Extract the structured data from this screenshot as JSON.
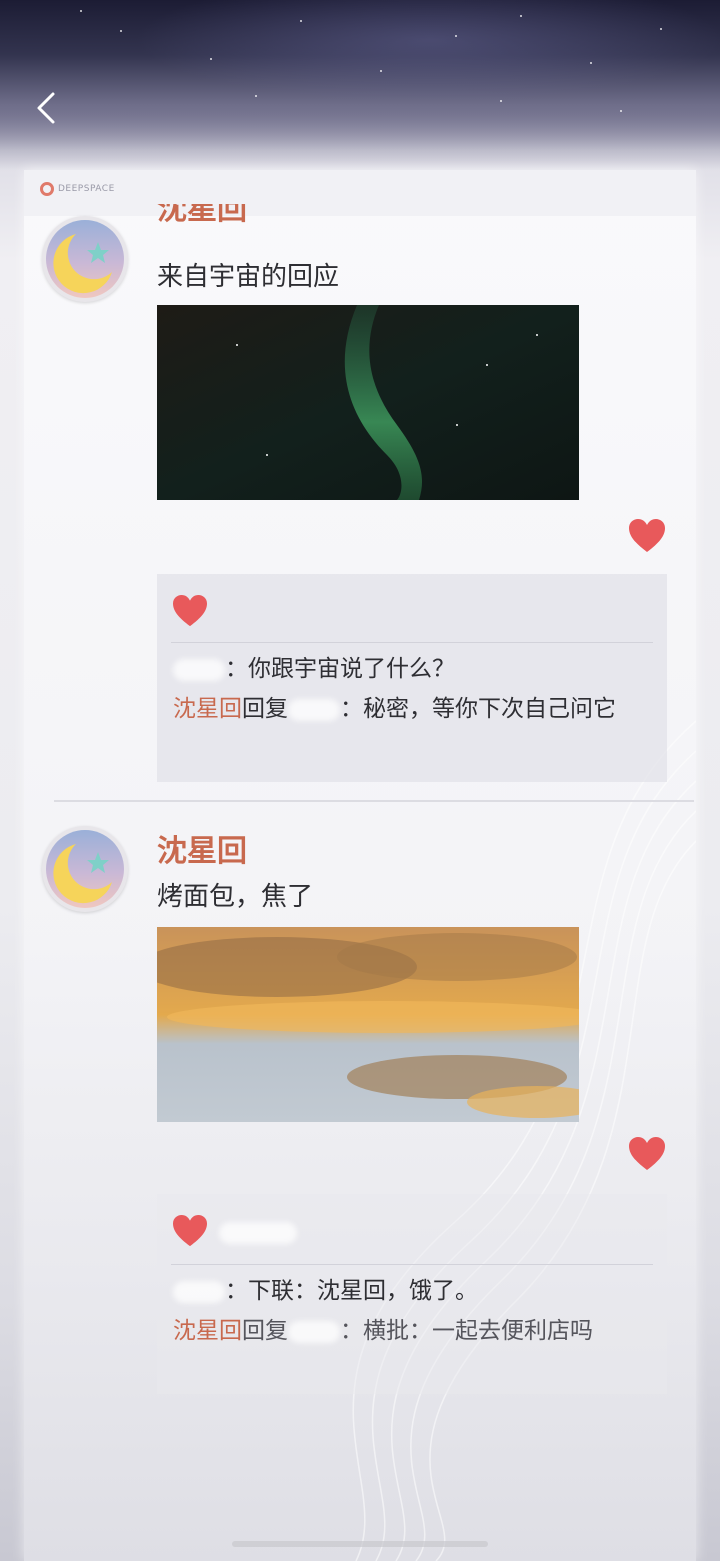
{
  "header": {
    "back_icon": "chevron-left-icon"
  },
  "card": {
    "brand_text": "DEEPSPACE"
  },
  "posts": [
    {
      "author": "沈星回",
      "text": "来自宇宙的回应",
      "photo": "aurora",
      "comments": [
        {
          "name": "",
          "text": "：你跟宇宙说了什么？"
        },
        {
          "name": "沈星回",
          "action": "回复",
          "target": "",
          "text": "：秘密，等你下次自己问它"
        }
      ]
    },
    {
      "author": "沈星回",
      "text": "烤面包，焦了",
      "photo": "sunset-clouds",
      "comments": [
        {
          "name": "",
          "text": "：下联：沈星回，饿了。"
        },
        {
          "name": "沈星回",
          "action": "回复",
          "target": "",
          "text": "：横批：一起去便利店吗"
        }
      ]
    }
  ],
  "colors": {
    "accent": "#c8694e",
    "heart": "#e8595b"
  }
}
